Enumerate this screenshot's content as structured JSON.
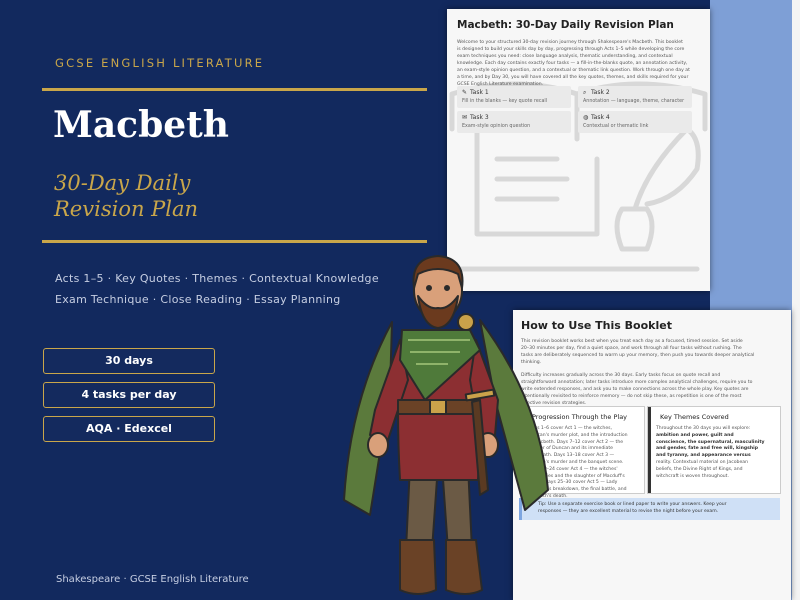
{
  "cover": {
    "kicker": "GCSE ENGLISH LITERATURE",
    "title": "Macbeth",
    "subtitle_line1": "30-Day Daily",
    "subtitle_line2": "Revision Plan",
    "topics_line1": "Acts 1–5 · Key Quotes · Themes · Contextual Knowledge",
    "topics_line2": "Exam Technique · Close Reading · Essay Planning",
    "pills": [
      "30 days",
      "4 tasks per day",
      "AQA · Edexcel"
    ],
    "footer": "Shakespeare · GCSE English Literature",
    "colors": {
      "navy": "#12295e",
      "gold": "#c9a64a",
      "side_blue": "#7e9fd6"
    }
  },
  "page1": {
    "title": "Macbeth: 30-Day Daily Revision Plan",
    "intro": [
      "Welcome to your structured 30-day revision journey through Shakespeare's Macbeth. This booklet",
      "is designed to build your skills day by day, progressing through Acts 1–5 while developing the core",
      "exam techniques you need: close language analysis, thematic understanding, and contextual",
      "knowledge. Each day contains exactly four tasks — a fill-in-the-blanks quote, an annotation activity,",
      "an exam-style opinion question, and a contextual or thematic link question. Work through one day at",
      "a time, and by Day 30, you will have covered all the key quotes, themes, and skills required for your",
      "GCSE English Literature examination."
    ],
    "tasks": [
      {
        "icon": "pencil-icon",
        "glyph": "✎",
        "label": "Task 1",
        "desc": "Fill in the blanks — key quote recall"
      },
      {
        "icon": "search-icon",
        "glyph": "⌕",
        "label": "Task 2",
        "desc": "Annotation — language, theme, character"
      },
      {
        "icon": "speech-bubble-icon",
        "glyph": "✉",
        "label": "Task 3",
        "desc": "Exam-style opinion question"
      },
      {
        "icon": "globe-icon",
        "glyph": "◍",
        "label": "Task 4",
        "desc": "Contextual or thematic link"
      }
    ]
  },
  "page2": {
    "title": "How to Use This Booklet",
    "para1": [
      "This revision booklet works best when you treat each day as a focused, timed session. Set aside",
      "20–30 minutes per day, find a quiet space, and work through all four tasks without rushing. The",
      "tasks are deliberately sequenced to warm up your memory, then push you towards deeper analytical",
      "thinking."
    ],
    "para2": [
      "Difficulty increases gradually across the 30 days. Early tasks focus on quote recall and",
      "straightforward annotation; later tasks introduce more complex analytical challenges, require you to",
      "write extended responses, and ask you to make connections across the whole play. Key quotes are",
      "intentionally revisited to reinforce memory — do not skip these, as repetition is one of the most",
      "effective revision strategies."
    ],
    "box_left": {
      "heading": "Progression Through the Play",
      "lines": [
        "Days 1–6 cover Act 1 — the witches,",
        "Duncan's murder plot, and the introduction",
        "of Macbeth. Days 7–12 cover Act 2 — the",
        "murder of Duncan and its immediate",
        "aftermath. Days 13–18 cover Act 3 —",
        "Banquo's murder and the banquet scene.",
        "Days 19–24 cover Act 4 — the witches'",
        "prophecies and the slaughter of Macduff's",
        "family. Days 25–30 cover Act 5 — Lady",
        "Macbeth's breakdown, the final battle, and",
        "Macbeth's death."
      ]
    },
    "box_right": {
      "heading": "Key Themes Covered",
      "lines": [
        "Throughout the 30 days you will explore:",
        "ambition and power, guilt and",
        "conscience, the supernatural, masculinity",
        "and gender, fate and free will, kingship",
        "and tyranny, and appearance versus",
        "reality. Contextual material on Jacobean",
        "beliefs, the Divine Right of Kings, and",
        "witchcraft is woven throughout."
      ]
    },
    "tip_line1": "Tip: Use a separate exercise book or lined paper to write your answers. Keep your",
    "tip_line2": "responses — they are excellent material to revise the night before your exam."
  },
  "illustration": {
    "icon": "warrior-figure-icon"
  }
}
